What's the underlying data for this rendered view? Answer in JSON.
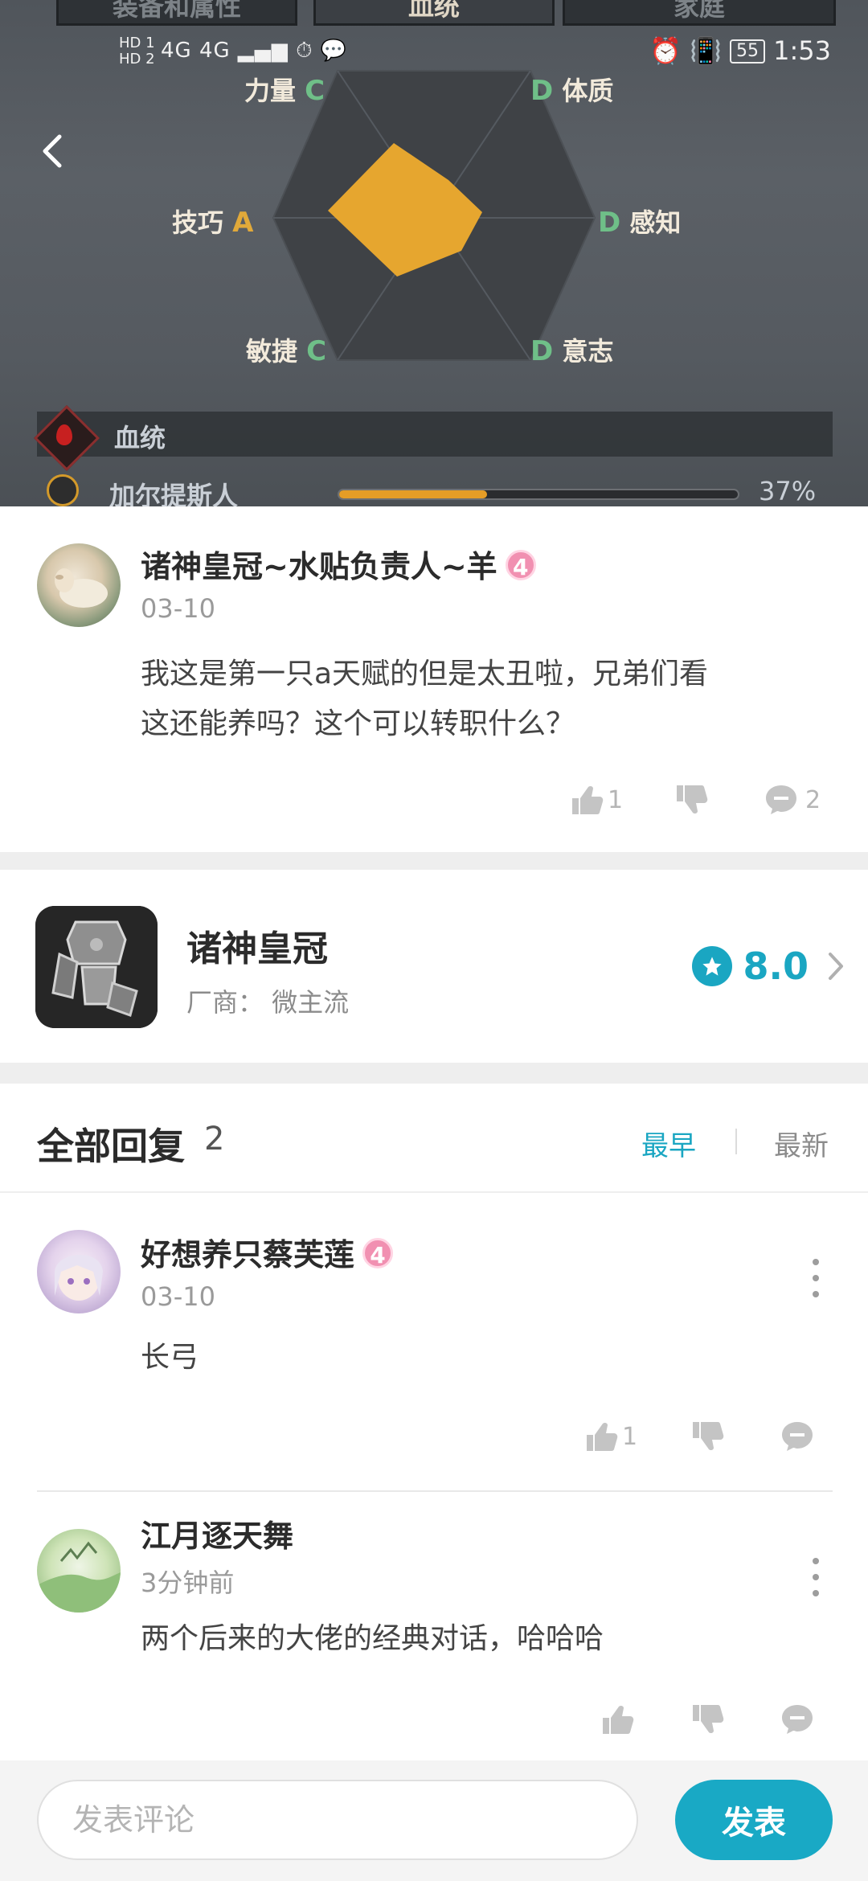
{
  "hero": {
    "tabs": [
      "装备和属性",
      "血统",
      "家庭"
    ],
    "status": {
      "hd1": "HD 1",
      "hd2": "HD 2",
      "signal": "4G 4G",
      "battery": "55",
      "time": "1:53"
    },
    "radar": {
      "top_left": {
        "label": "力量",
        "grade": "C"
      },
      "top_right": {
        "label": "体质",
        "grade": "D"
      },
      "mid_left": {
        "label": "技巧",
        "grade": "A"
      },
      "mid_right": {
        "label": "感知",
        "grade": "D"
      },
      "bottom_left": {
        "label": "敏捷",
        "grade": "C"
      },
      "bottom_right": {
        "label": "意志",
        "grade": "D"
      }
    },
    "bloodline_label": "血统",
    "lineage": {
      "name": "加尔提斯人",
      "percent_text": "37%",
      "progress": 0.37
    },
    "colors": {
      "grade_a": "#e1a93a",
      "grade_cd": "#6fbf88",
      "progress": "#e59d26"
    }
  },
  "post": {
    "username": "诸神皇冠~水贴负责人~羊",
    "level": "4",
    "date": "03-10",
    "content_line1": "我这是第一只a天赋的但是太丑啦，兄弟们看",
    "content_line2": "这还能养吗？这个可以转职什么？",
    "likes": "1",
    "comments": "2"
  },
  "game": {
    "name": "诸神皇冠",
    "developer": "厂商：  微主流",
    "rating": "8.0"
  },
  "replies": {
    "title": "全部回复",
    "count": "2",
    "sort_earliest": "最早",
    "sort_newest": "最新",
    "items": [
      {
        "username": "好想养只蔡芙莲",
        "level": "4",
        "date": "03-10",
        "content": "长弓",
        "likes": "1"
      },
      {
        "username": "江月逐天舞",
        "date": "3分钟前",
        "content": "两个后来的大佬的经典对话，哈哈哈"
      }
    ]
  },
  "bottom": {
    "placeholder": "发表评论",
    "submit": "发表"
  },
  "accent_color": "#1aa6c2"
}
